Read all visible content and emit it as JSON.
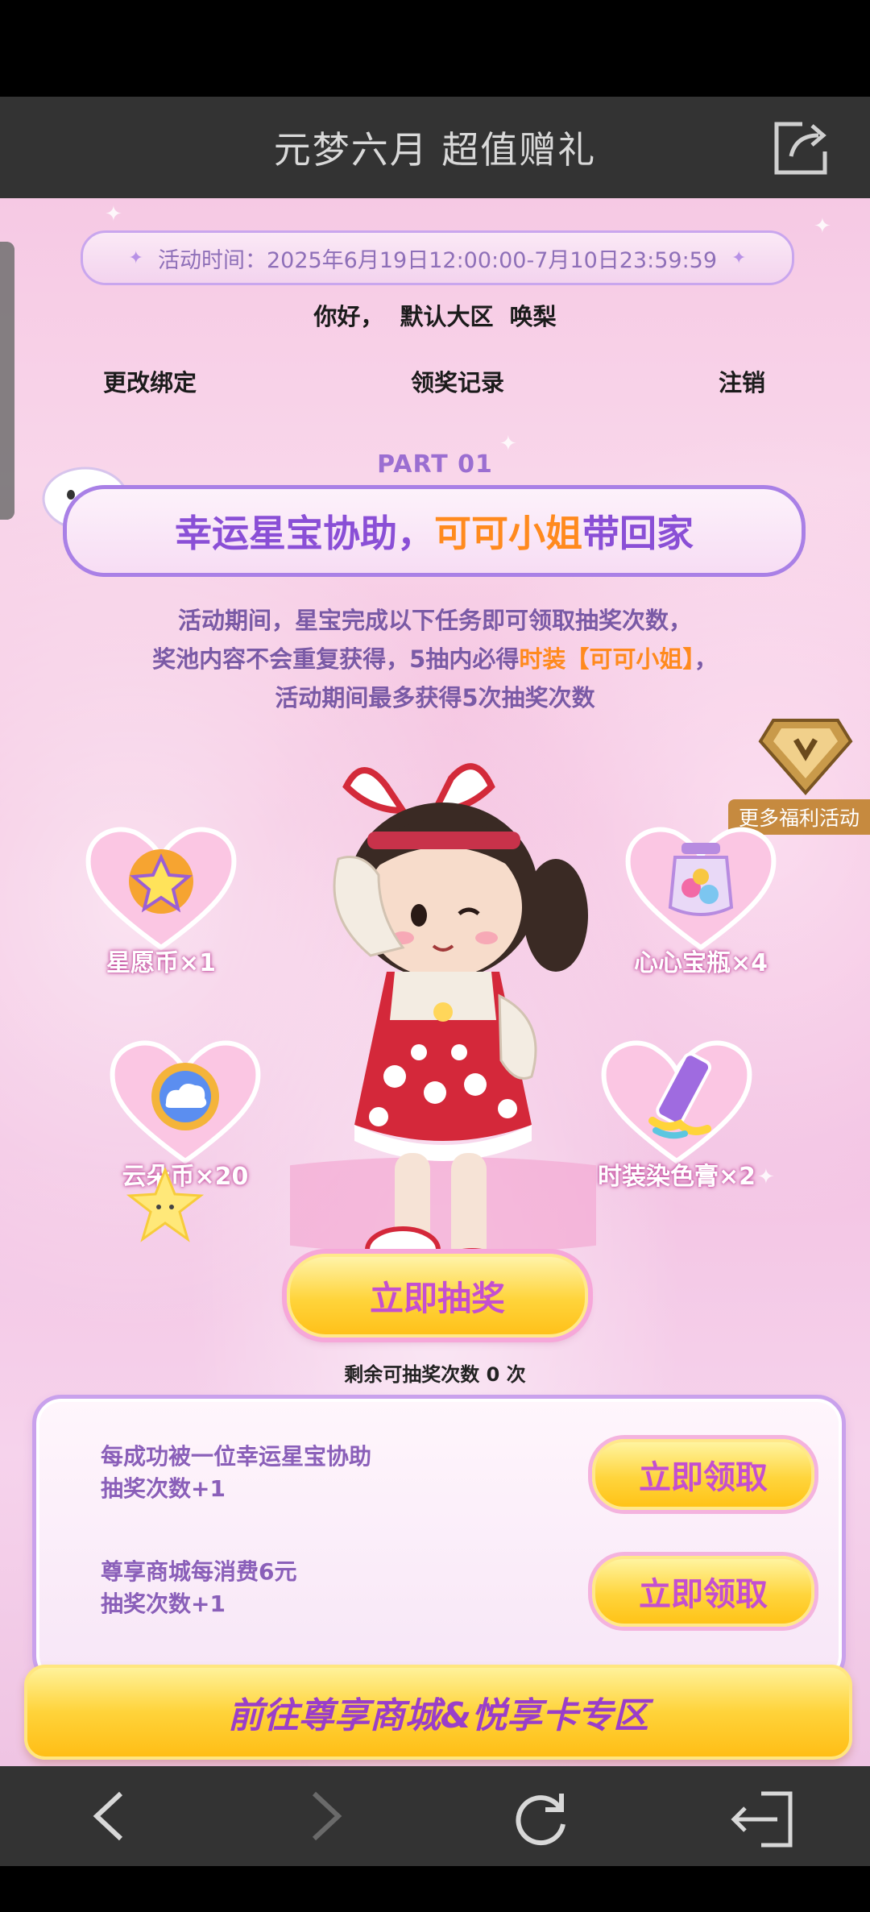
{
  "header": {
    "title": "元梦六月 超值赠礼",
    "share_icon": "share-icon"
  },
  "event": {
    "time": "活动时间：2025年6月19日12:00:00-7月10日23:59:59"
  },
  "user": {
    "greeting": "你好，",
    "region": "默认大区",
    "name": "唤梨"
  },
  "account_links": {
    "change_binding": "更改绑定",
    "claim_records": "领奖记录",
    "logout": "注销"
  },
  "part": {
    "label": "PART 01",
    "title_main": "幸运星宝协助，",
    "title_highlight": "可可小姐",
    "title_tail": "带回家"
  },
  "description": {
    "line1": "活动期间，星宝完成以下任务即可领取抽奖次数，",
    "line2_a": "奖池内容不会重复获得，5抽内必得",
    "line2_highlight": "时装【可可小姐】",
    "line2_b": "，",
    "line3": "活动期间最多获得5次抽奖次数"
  },
  "more_benefits": {
    "label": "更多福利活动"
  },
  "rewards": [
    {
      "label": "星愿币×1",
      "icon": "star-coin-icon"
    },
    {
      "label": "心心宝瓶×4",
      "icon": "heart-bottle-icon"
    },
    {
      "label": "云朵币×20",
      "icon": "cloud-coin-icon"
    },
    {
      "label": "时装染色膏×2",
      "icon": "dye-tube-icon"
    }
  ],
  "draw": {
    "button": "立即抽奖",
    "remaining_prefix": "剩余可抽奖次数",
    "remaining_count": "0",
    "remaining_suffix": "次"
  },
  "tasks": [
    {
      "line1": "每成功被一位幸运星宝协助",
      "line2": "抽奖次数+1",
      "button": "立即领取"
    },
    {
      "line1": "尊享商城每消费6元",
      "line2": "抽奖次数+1",
      "button": "立即领取"
    }
  ],
  "goto_button": "前往尊享商城&悦享卡专区",
  "nav": {
    "back_icon": "back-icon",
    "forward_icon": "forward-icon",
    "refresh_icon": "refresh-icon",
    "exit_icon": "exit-icon"
  }
}
